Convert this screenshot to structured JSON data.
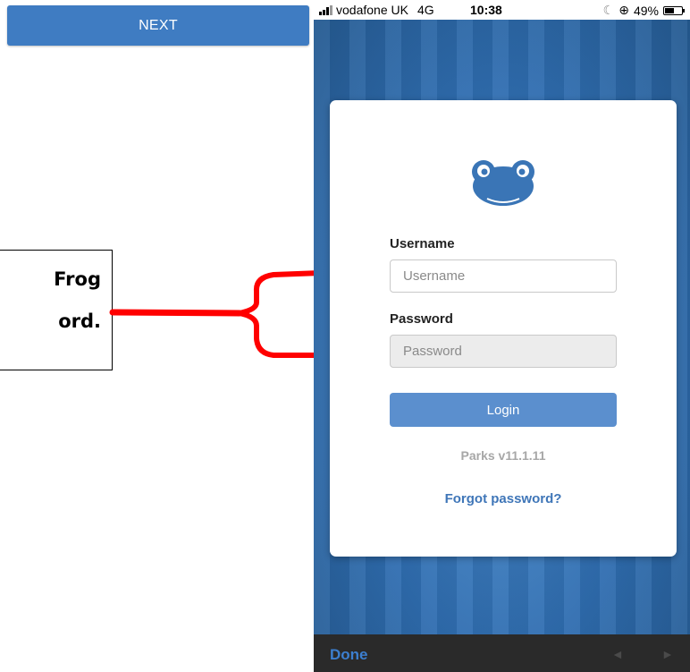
{
  "left_panel": {
    "next_label": "NEXT",
    "callout_line1": "Frog",
    "callout_line2": "ord."
  },
  "status_bar": {
    "carrier": "vodafone UK",
    "network": "4G",
    "time": "10:38",
    "moon": "☾",
    "lock": "⊕",
    "battery": "49%"
  },
  "login": {
    "username_label": "Username",
    "username_placeholder": "Username",
    "password_label": "Password",
    "password_placeholder": "Password",
    "login_label": "Login",
    "version": "Parks v11.1.11",
    "forgot_label": "Forgot password?"
  },
  "keyboard_bar": {
    "done_label": "Done",
    "prev_arrow": "◄",
    "next_arrow": "►"
  },
  "colors": {
    "accent": "#3f7cc2",
    "connector": "#ff0000"
  }
}
